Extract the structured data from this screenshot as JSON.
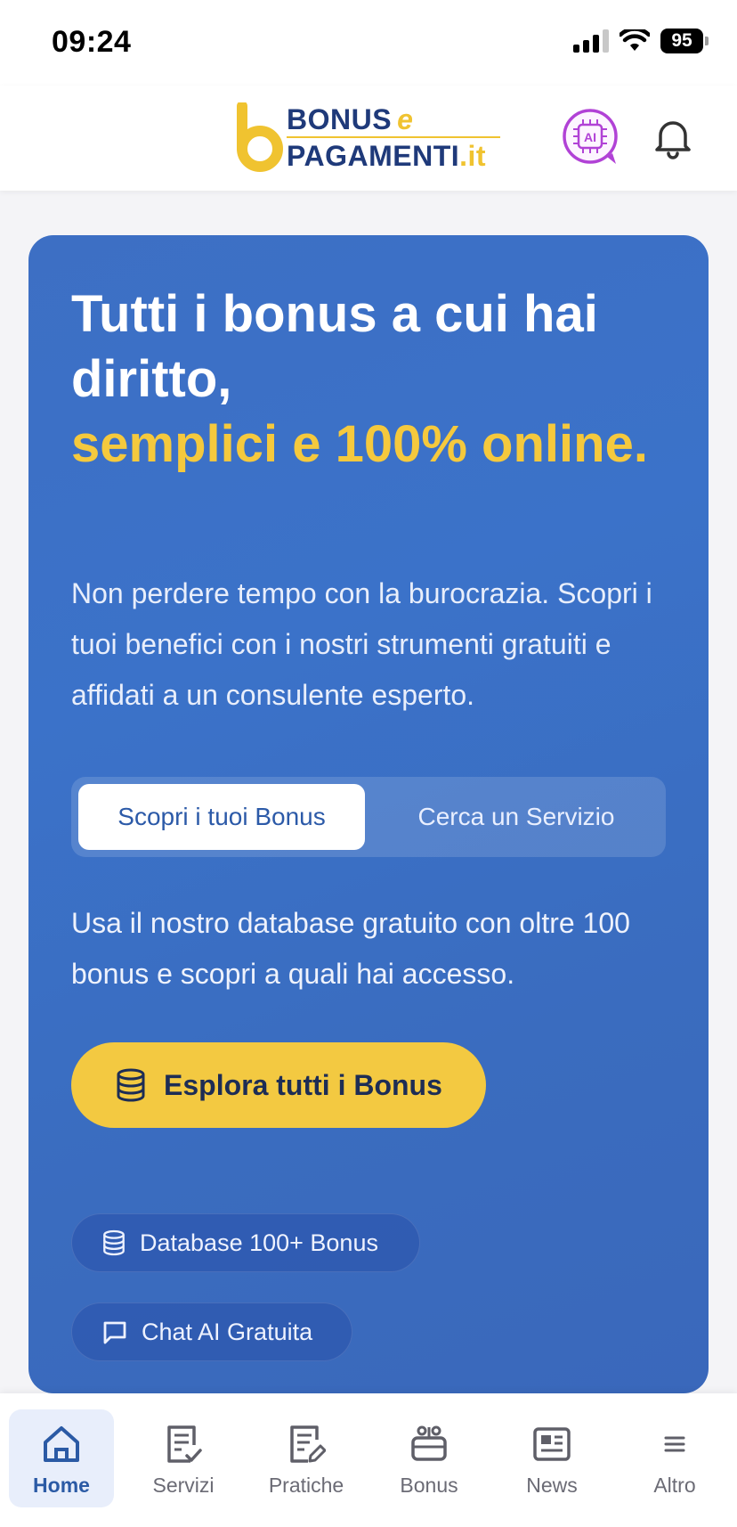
{
  "status_bar": {
    "time": "09:24",
    "battery": "95"
  },
  "header": {
    "logo": {
      "line1": "BONUS",
      "e": "e",
      "line2": "PAGAMENTI",
      "tld": ".it"
    },
    "ai_icon": "ai-chip-icon",
    "bell_icon": "bell-icon"
  },
  "hero": {
    "title_line1": "Tutti i bonus a cui hai diritto,",
    "title_highlight": "semplici e 100% online.",
    "description": "Non perdere tempo con la burocrazia. Scopri i tuoi benefici con i nostri strumenti gratuiti e affidati a un consulente esperto.",
    "tabs": [
      {
        "label": "Scopri i tuoi Bonus",
        "active": true
      },
      {
        "label": "Cerca un Servizio",
        "active": false
      }
    ],
    "subtext": "Usa il nostro database gratuito con oltre 100 bonus e scopri a quali hai accesso.",
    "cta_label": "Esplora tutti i Bonus",
    "chips": [
      {
        "label": "Database 100+ Bonus",
        "icon": "database-icon"
      },
      {
        "label": "Chat AI Gratuita",
        "icon": "chat-icon"
      }
    ]
  },
  "bottom_nav": [
    {
      "label": "Home",
      "icon": "home-icon",
      "active": true
    },
    {
      "label": "Servizi",
      "icon": "document-check-icon",
      "active": false
    },
    {
      "label": "Pratiche",
      "icon": "document-edit-icon",
      "active": false
    },
    {
      "label": "Bonus",
      "icon": "gift-box-icon",
      "active": false
    },
    {
      "label": "News",
      "icon": "newspaper-icon",
      "active": false
    },
    {
      "label": "Altro",
      "icon": "menu-icon",
      "active": false
    }
  ],
  "colors": {
    "brand_blue": "#1f3a7a",
    "brand_yellow": "#f0c330",
    "hero_blue": "#3b72c9",
    "cta_yellow": "#f3c941",
    "ai_purple": "#b142d6"
  }
}
